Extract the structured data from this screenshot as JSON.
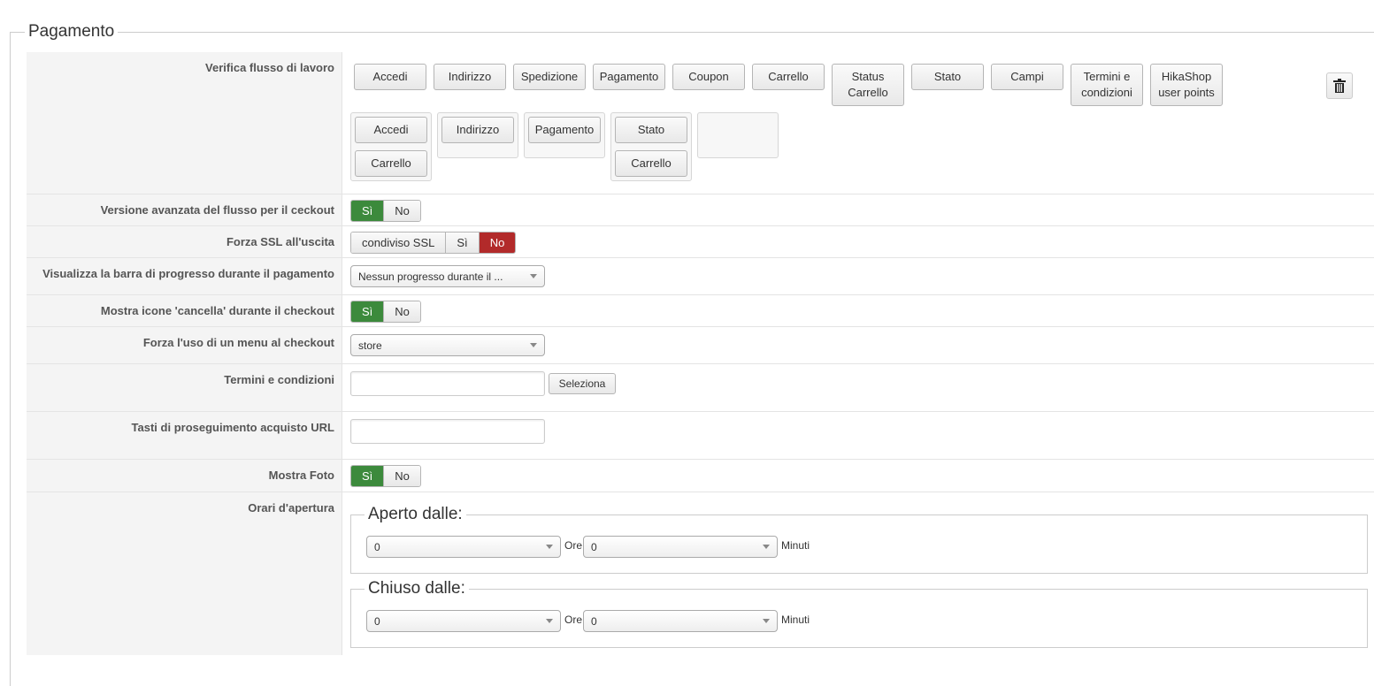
{
  "section_title": "Pagamento",
  "workflow": {
    "label": "Verifica flusso di lavoro",
    "available_buttons": [
      "Accedi",
      "Indirizzo",
      "Spedizione",
      "Pagamento",
      "Coupon",
      "Carrello",
      "Status\nCarrello",
      "Stato",
      "Campi",
      "Termini e\ncondizioni",
      "HikaShop\nuser points"
    ],
    "groups": [
      [
        "Accedi",
        "Carrello"
      ],
      [
        "Indirizzo"
      ],
      [
        "Pagamento"
      ],
      [
        "Stato",
        "Carrello"
      ],
      []
    ],
    "trash_icon": "trash-icon"
  },
  "advanced_flow": {
    "label": "Versione avanzata del flusso per il ceckout",
    "yes": "Sì",
    "no": "No",
    "selected": "Sì"
  },
  "force_ssl": {
    "label": "Forza SSL all'uscita",
    "options": [
      "condiviso SSL",
      "Sì",
      "No"
    ],
    "selected": "No"
  },
  "progress_bar": {
    "label": "Visualizza la barra di progresso durante il pagamento",
    "value": "Nessun progresso durante il ..."
  },
  "cancel_icons": {
    "label": "Mostra icone 'cancella' durante il checkout",
    "yes": "Sì",
    "no": "No",
    "selected": "Sì"
  },
  "force_menu": {
    "label": "Forza l'uso di un menu al checkout",
    "value": "store"
  },
  "terms": {
    "label": "Termini e condizioni",
    "value": "",
    "button": "Seleziona"
  },
  "continue_url": {
    "label": "Tasti di proseguimento acquisto URL",
    "value": ""
  },
  "show_photo": {
    "label": "Mostra Foto",
    "yes": "Sì",
    "no": "No",
    "selected": "Sì"
  },
  "opening_hours": {
    "label": "Orari d'apertura",
    "open": {
      "legend": "Aperto dalle:",
      "hours": "0",
      "hours_unit": "Ore",
      "minutes": "0",
      "minutes_unit": "Minuti"
    },
    "close": {
      "legend": "Chiuso dalle:",
      "hours": "0",
      "hours_unit": "Ore",
      "minutes": "0",
      "minutes_unit": "Minuti"
    }
  },
  "colors": {
    "yes_active": "#3c8a3c",
    "no_active": "#b22a2a"
  }
}
